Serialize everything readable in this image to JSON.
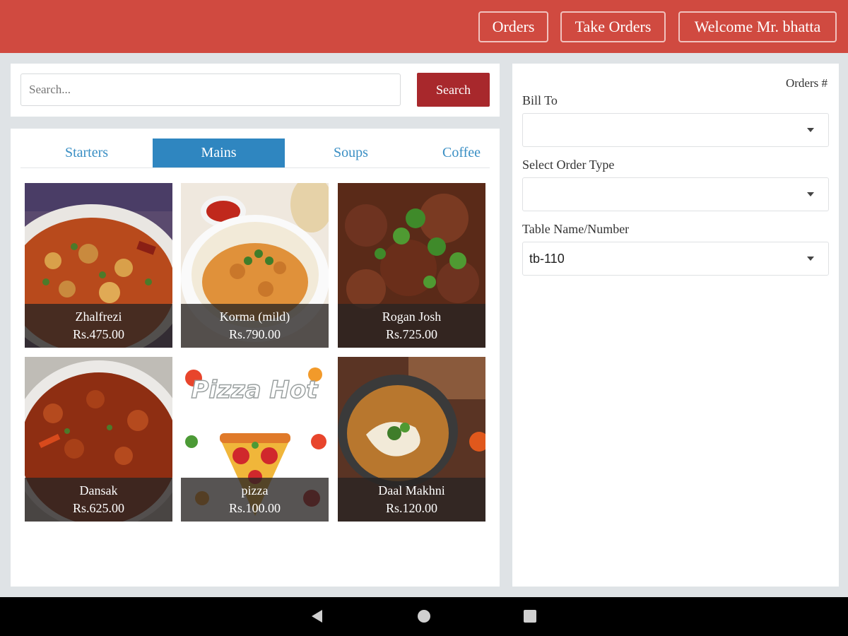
{
  "header": {
    "orders_label": "Orders",
    "take_orders_label": "Take Orders",
    "welcome_label": "Welcome Mr. bhatta",
    "bar_color": "#d04a40"
  },
  "search": {
    "placeholder": "Search...",
    "button_label": "Search"
  },
  "tabs": [
    {
      "label": "Starters",
      "active": false
    },
    {
      "label": "Mains",
      "active": true
    },
    {
      "label": "Soups",
      "active": false
    },
    {
      "label": "Coffee",
      "active": false
    }
  ],
  "menu_items": [
    {
      "name": "Zhalfrezi",
      "price": "Rs.475.00"
    },
    {
      "name": "Korma (mild)",
      "price": "Rs.790.00"
    },
    {
      "name": "Rogan Josh",
      "price": "Rs.725.00"
    },
    {
      "name": "Dansak",
      "price": "Rs.625.00"
    },
    {
      "name": "pizza",
      "price": "Rs.100.00",
      "image_text": "Pizza Hot"
    },
    {
      "name": "Daal Makhni",
      "price": "Rs.120.00"
    }
  ],
  "order": {
    "orders_hash_label": "Orders #",
    "bill_to_label": "Bill To",
    "bill_to_value": "",
    "order_type_label": "Select Order Type",
    "order_type_value": "",
    "table_label": "Table Name/Number",
    "table_value": "tb-110"
  },
  "nav": {
    "icons": [
      "back-icon",
      "home-icon",
      "recent-apps-icon"
    ]
  }
}
